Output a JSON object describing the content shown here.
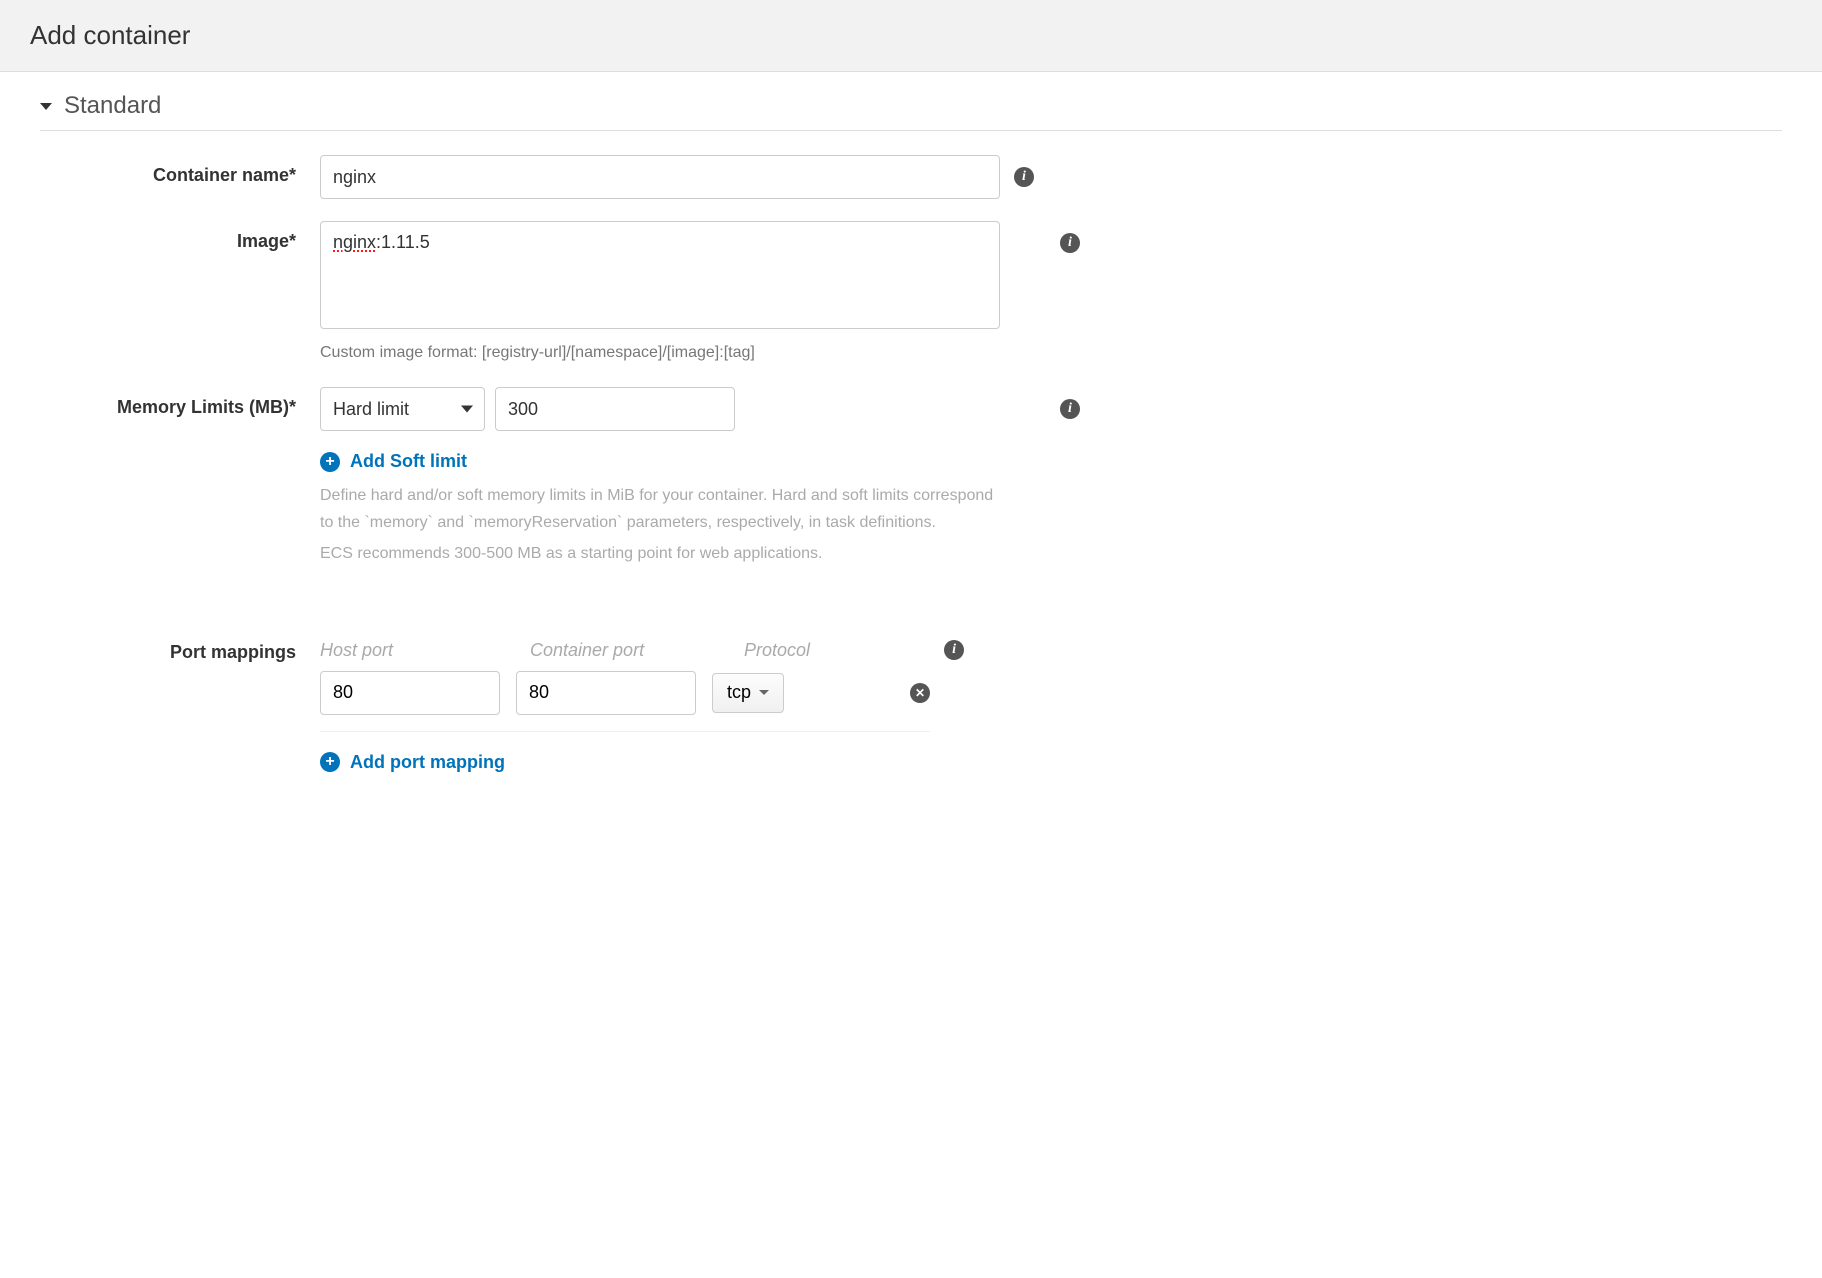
{
  "header": {
    "title": "Add container"
  },
  "section": {
    "title": "Standard"
  },
  "form": {
    "container_name": {
      "label": "Container name*",
      "value": "nginx"
    },
    "image": {
      "label": "Image*",
      "value_part1": "nginx",
      "value_part2": ":1.11.5",
      "help": "Custom image format: [registry-url]/[namespace]/[image]:[tag]"
    },
    "memory": {
      "label": "Memory Limits (MB)*",
      "limit_type": "Hard limit",
      "limit_value": "300",
      "add_soft_label": "Add Soft limit",
      "help1": "Define hard and/or soft memory limits in MiB for your container. Hard and soft limits correspond to the `memory` and `memoryReservation` parameters, respectively, in task definitions.",
      "help2": "ECS recommends 300-500 MB as a starting point for web applications."
    },
    "ports": {
      "label": "Port mappings",
      "headers": {
        "host": "Host port",
        "container": "Container port",
        "protocol": "Protocol"
      },
      "rows": [
        {
          "host": "80",
          "container": "80",
          "protocol": "tcp"
        }
      ],
      "add_label": "Add port mapping"
    }
  }
}
